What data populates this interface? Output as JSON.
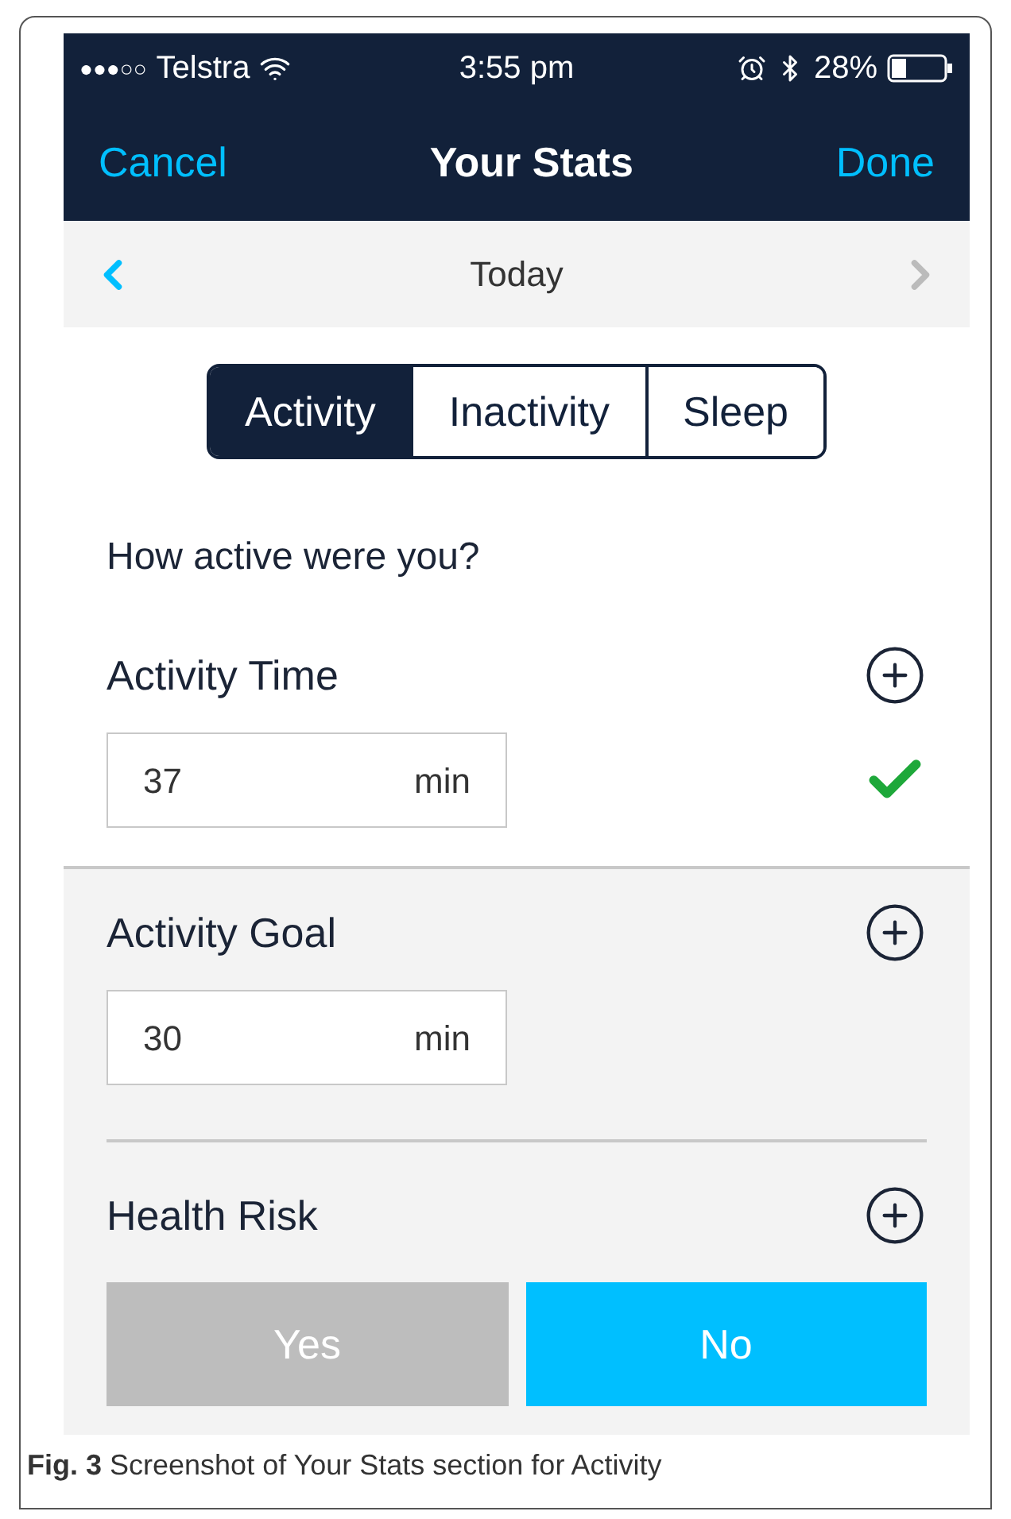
{
  "status_bar": {
    "signal": "●●●○○",
    "carrier": "Telstra",
    "time": "3:55 pm",
    "battery": "28%"
  },
  "nav_bar": {
    "left": "Cancel",
    "title": "Your Stats",
    "right": "Done"
  },
  "date_bar": {
    "label": "Today"
  },
  "tabs": [
    {
      "label": "Activity",
      "selected": true
    },
    {
      "label": "Inactivity",
      "selected": false
    },
    {
      "label": "Sleep",
      "selected": false
    }
  ],
  "question": "How active were you?",
  "fields": [
    {
      "label": "Activity Time",
      "value": "37",
      "unit": "min",
      "valid": true
    },
    {
      "label": "Activity Goal",
      "value": "30",
      "unit": "min",
      "valid": false
    }
  ],
  "health_risk": {
    "label": "Health Risk",
    "options": [
      {
        "label": "Yes",
        "selected": false
      },
      {
        "label": "No",
        "selected": true
      }
    ]
  },
  "caption": "**Fig. 3** Screenshot of Your Stats section for Activity"
}
